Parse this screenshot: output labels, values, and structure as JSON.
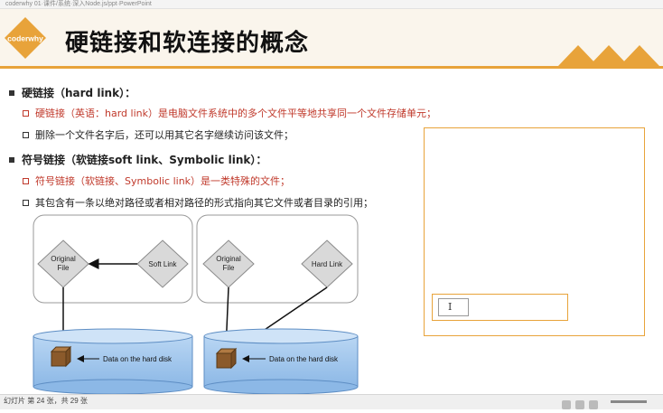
{
  "window": {
    "title_bar_text": "coderwhy 01·课件/系统·深入Node.js/ppt·PowerPoint"
  },
  "slide": {
    "logo_text": "coderwhy",
    "title": "硬链接和软连接的概念",
    "hard_link": {
      "heading": "硬链接（hard link）：",
      "items": [
        {
          "text": "硬链接（英语：hard link）是电脑文件系统中的多个文件平等地共享同一个文件存储单元；",
          "color": "#c0392b"
        },
        {
          "text": "删除一个文件名字后，还可以用其它名字继续访问该文件；",
          "color": "#222222"
        }
      ]
    },
    "soft_link": {
      "heading": "符号链接（软链接soft link、Symbolic link）：",
      "items": [
        {
          "text": "符号链接（软链接、Symbolic link）是一类特殊的文件；",
          "color": "#c0392b"
        },
        {
          "text": "其包含有一条以绝对路径或者相对路径的形式指向其它文件或者目录的引用；",
          "color": "#222222"
        }
      ]
    },
    "diagram": {
      "left": {
        "file_label_1": "Original",
        "file_label_2": "File",
        "link_label": "Soft Link",
        "disk_label": "Data on the hard disk"
      },
      "right": {
        "file_label_1": "Original",
        "file_label_2": "File",
        "link_label": "Hard Link",
        "disk_label": "Data on the hard disk"
      }
    },
    "panel": {
      "cursor_glyph": "I"
    }
  },
  "status_bar": {
    "text": "幻灯片 第 24 张，共 29 张"
  },
  "colors": {
    "accent": "#e8a33a",
    "red": "#c0392b",
    "disk_blue": "#9cc3ea"
  }
}
